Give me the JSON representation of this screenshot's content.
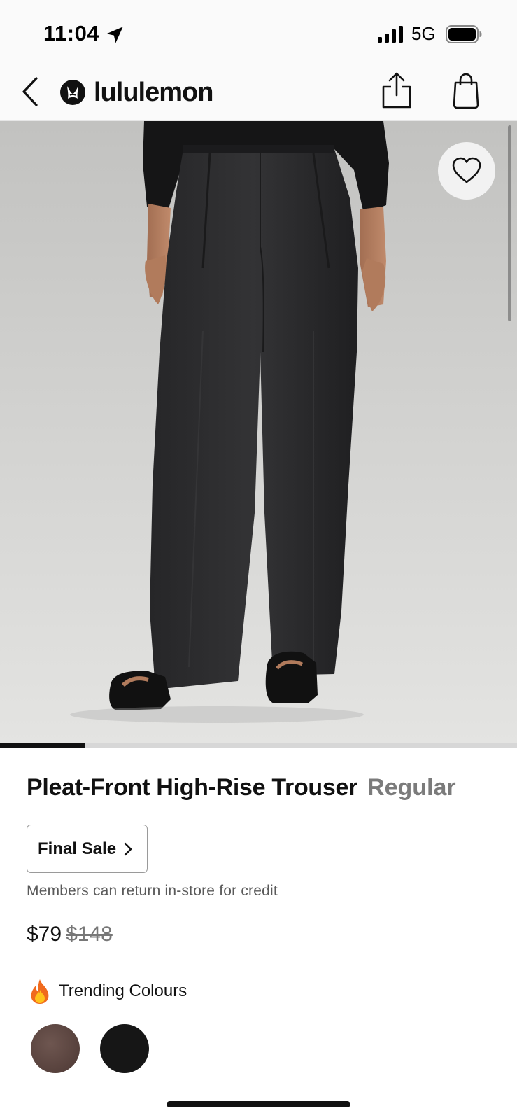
{
  "status_bar": {
    "time": "11:04",
    "network": "5G",
    "icons": [
      "location-arrow-icon",
      "signal-bars-icon",
      "battery-icon"
    ]
  },
  "nav": {
    "brand_name": "lululemon",
    "icons": [
      "back-chevron-icon",
      "lululemon-logo-icon",
      "share-icon",
      "shopping-bag-icon"
    ]
  },
  "hero": {
    "favorite_icon": "heart-icon",
    "carousel_progress": 0.165
  },
  "product": {
    "title": "Pleat-Front High-Rise Trouser",
    "fit": "Regular",
    "final_sale_label": "Final Sale",
    "return_note": "Members can return in-store for credit",
    "price": "$79",
    "original_price": "$148",
    "trending_label": "Trending Colours",
    "trending_icon": "flame-icon",
    "swatches": [
      {
        "name": "brown",
        "color": "#5a443f"
      },
      {
        "name": "black",
        "color": "#161616"
      }
    ]
  },
  "colors": {
    "text": "#111111",
    "muted": "#7b7b7b",
    "pant": "#2b2b2d",
    "background": "#d3d3d1"
  }
}
